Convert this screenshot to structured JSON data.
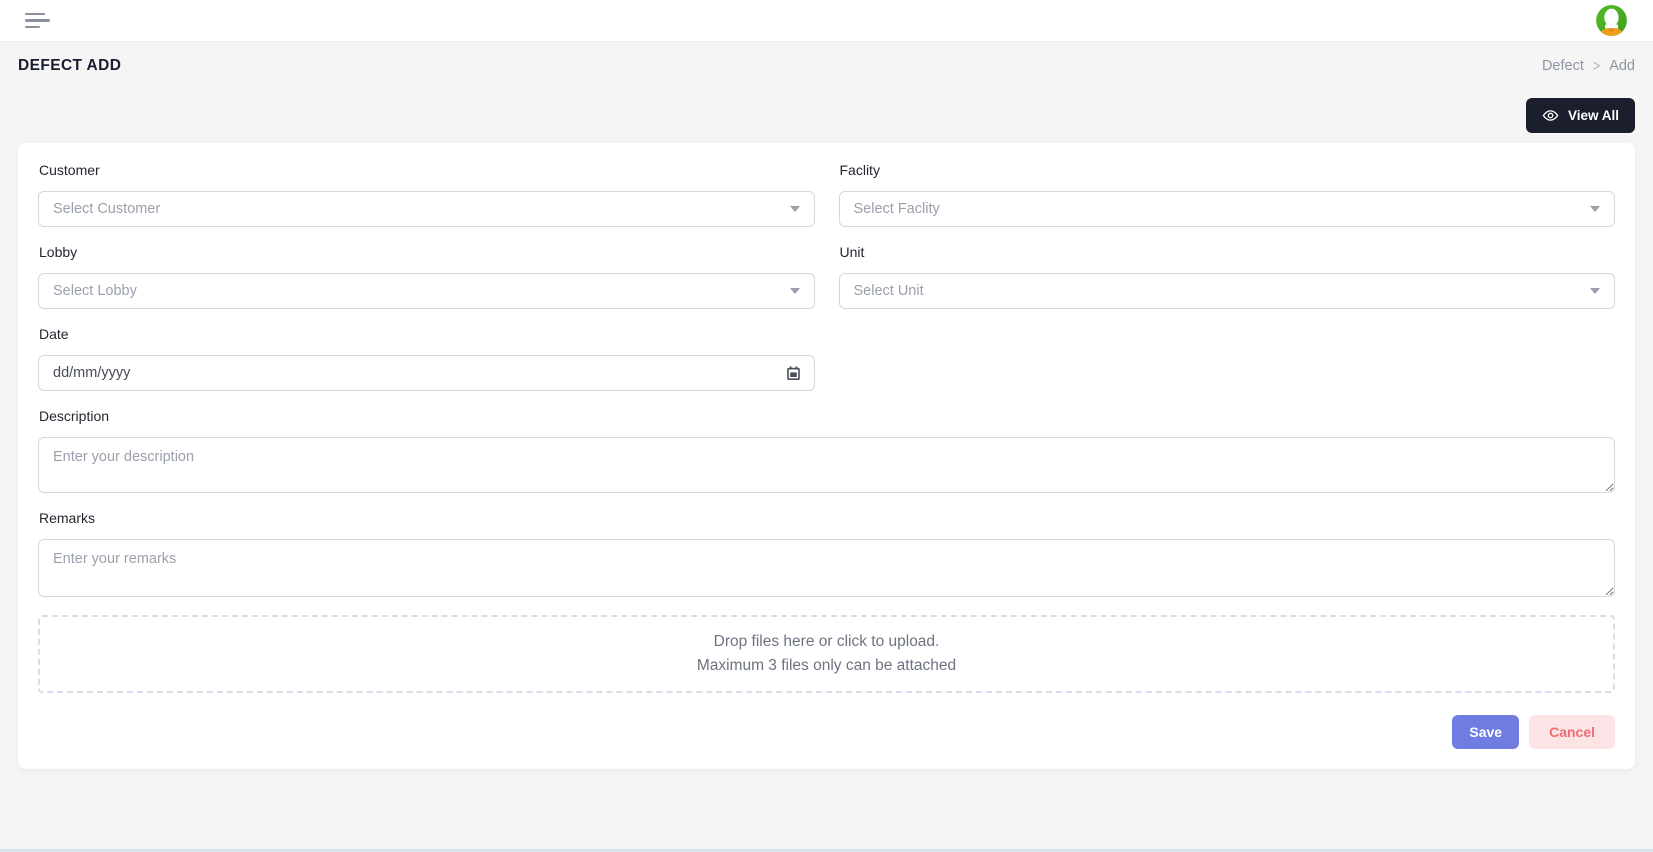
{
  "topbar": {
    "menu_icon": "hamburger",
    "avatar_icon": "user-silhouette"
  },
  "page": {
    "title": "DEFECT ADD",
    "breadcrumb": {
      "items": [
        "Defect",
        "Add"
      ],
      "separator": ">"
    }
  },
  "toolbar": {
    "view_all_label": "View All",
    "view_all_icon": "eye"
  },
  "form": {
    "fields": {
      "customer": {
        "label": "Customer",
        "placeholder": "Select Customer"
      },
      "facility": {
        "label": "Faclity",
        "placeholder": "Select Faclity"
      },
      "lobby": {
        "label": "Lobby",
        "placeholder": "Select Lobby"
      },
      "unit": {
        "label": "Unit",
        "placeholder": "Select Unit"
      },
      "date": {
        "label": "Date",
        "placeholder": "dd/mm/yyyy",
        "icon": "calendar"
      },
      "description": {
        "label": "Description",
        "placeholder": "Enter your description",
        "value": ""
      },
      "remarks": {
        "label": "Remarks",
        "placeholder": "Enter your remarks",
        "value": ""
      }
    },
    "select_icon": "caret-down",
    "dropzone": {
      "line1": "Drop files here or click to upload.",
      "line2": "Maximum 3 files only can be attached",
      "max_files": 3
    },
    "actions": {
      "save": "Save",
      "cancel": "Cancel"
    }
  },
  "colors": {
    "page_background": "#f5f5f6",
    "view_all_bg": "#1b1e2c",
    "save_bg": "#6f7de3",
    "cancel_bg": "#fce3e5",
    "cancel_text": "#ef6e76",
    "avatar_green": "#4cae27",
    "avatar_orange": "#f09d1b"
  }
}
